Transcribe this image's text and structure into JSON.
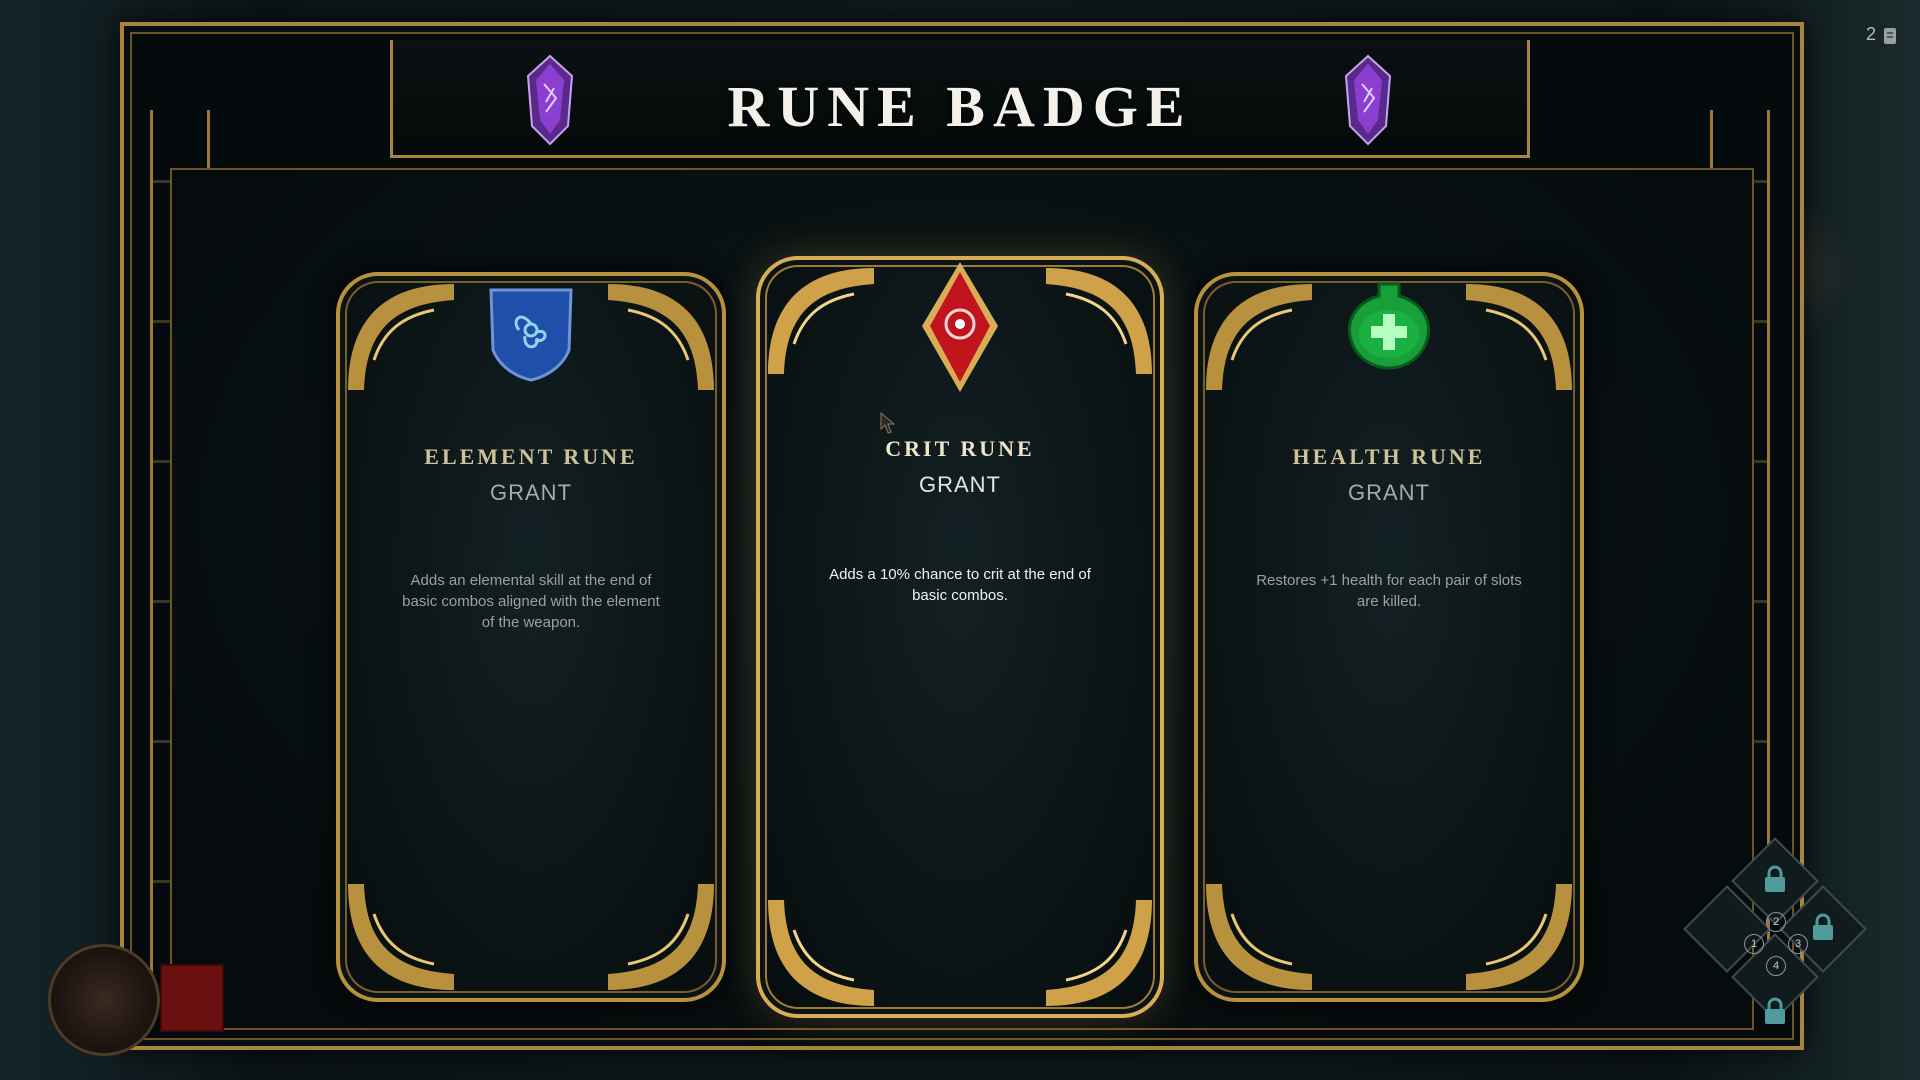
{
  "header": {
    "title": "RUNE BADGE",
    "page_counter": "2"
  },
  "cards": [
    {
      "name": "ELEMENT RUNE",
      "action": "GRANT",
      "description": "Adds an elemental skill at the end of basic combos aligned with the element of the weapon.",
      "icon": "element-rune-icon",
      "color": "#1f4fa8"
    },
    {
      "name": "CRIT RUNE",
      "action": "GRANT",
      "description": "Adds a 10% chance to crit at the end of basic combos.",
      "icon": "crit-rune-icon",
      "color": "#c0141e"
    },
    {
      "name": "HEALTH RUNE",
      "action": "GRANT",
      "description": "Restores +1 health for each pair of slots are killed.",
      "icon": "health-rune-icon",
      "color": "#17a03a"
    }
  ],
  "hud": {
    "slots": [
      {
        "num": "1",
        "locked": false
      },
      {
        "num": "2",
        "locked": false
      },
      {
        "num": "3",
        "locked": false
      },
      {
        "num": "4",
        "locked": false
      }
    ],
    "locked_slots": 3
  },
  "colors": {
    "gold": "#a8843c",
    "gold_light": "#d9ad55",
    "title": "#f4f1ea",
    "gem_purple": "#8a3fd1",
    "lock": "#4f9a9c"
  }
}
